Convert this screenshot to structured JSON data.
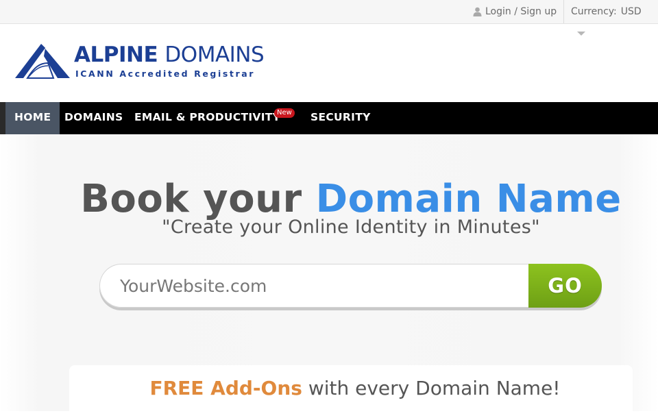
{
  "topbar": {
    "login_label": "Login / Sign up",
    "currency_label": "Currency:",
    "currency_value": "USD"
  },
  "brand": {
    "name_bold": "ALPINE",
    "name_rest": "DOMAINS",
    "tagline": "ICANN Accredited Registrar",
    "color": "#1c3f94"
  },
  "nav": {
    "items": [
      {
        "label": "HOME",
        "active": true
      },
      {
        "label": "DOMAINS",
        "active": false
      },
      {
        "label": "EMAIL & PRODUCTIVITY",
        "active": false,
        "badge": "New"
      },
      {
        "label": "SECURITY",
        "active": false
      }
    ]
  },
  "hero": {
    "title_part1": "Book your",
    "title_part2": "Domain Name",
    "subtitle": "\"Create your Online Identity in Minutes\"",
    "search_placeholder": "YourWebsite.com",
    "go_label": "GO"
  },
  "addons": {
    "accent": "FREE Add-Ons",
    "rest": "with every Domain Name!"
  },
  "colors": {
    "accent_blue": "#3a8ee6",
    "go_green": "#7cb319",
    "addons_orange": "#e08a3c",
    "badge_red": "#c8161d"
  }
}
